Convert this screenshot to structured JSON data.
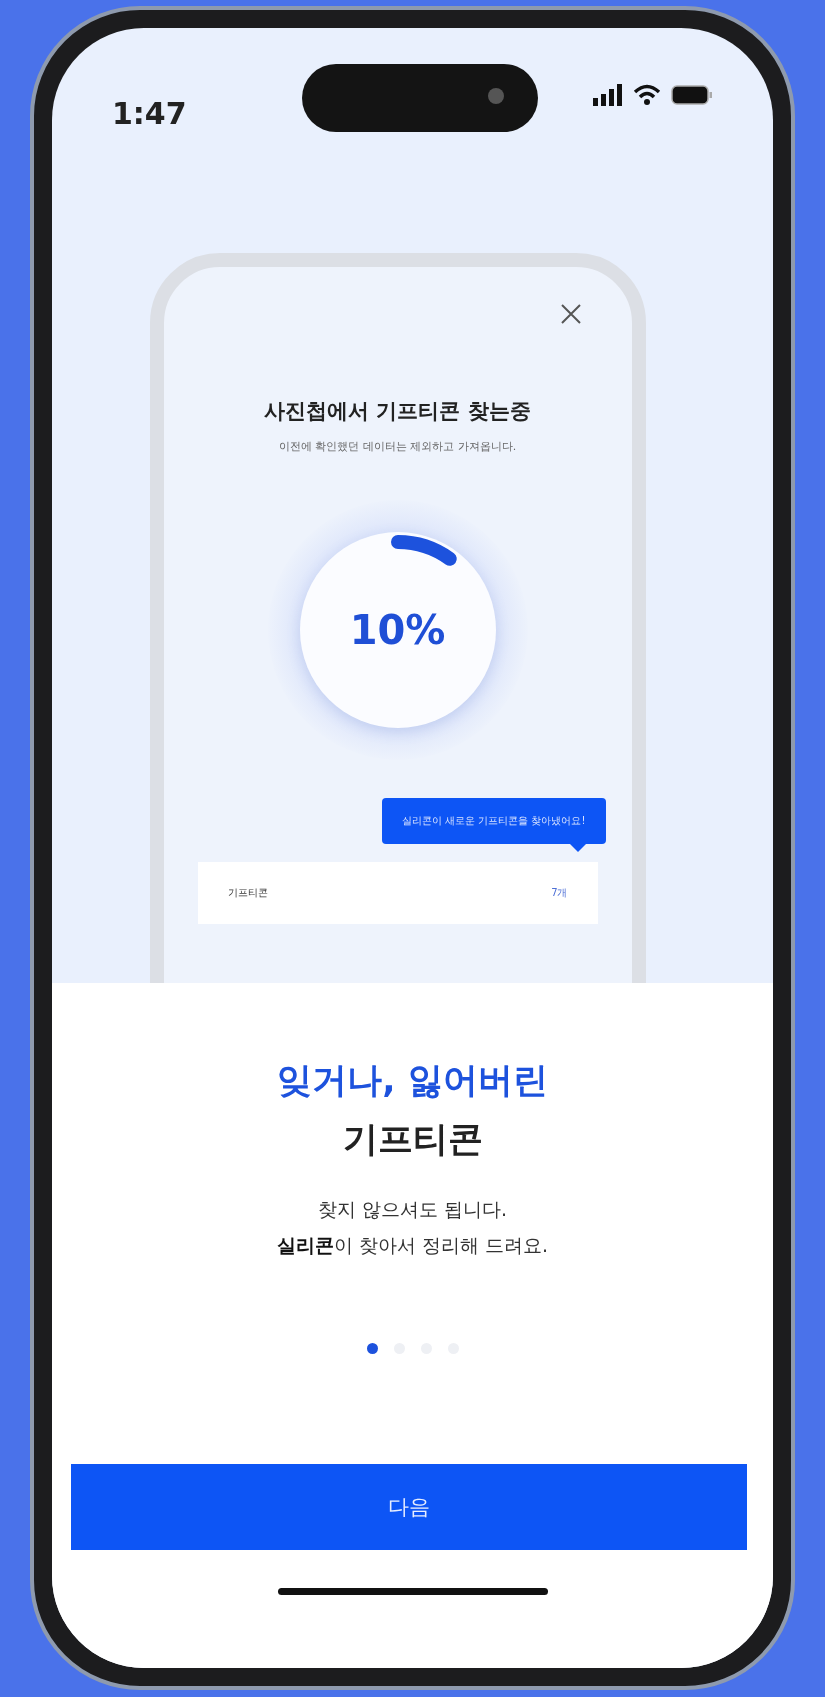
{
  "status_bar": {
    "time": "1:47"
  },
  "preview": {
    "title": "사진첩에서 기프티콘 찾는중",
    "subtitle": "이전에 확인했던 데이터는 제외하고 가져옵니다.",
    "progress": {
      "level": 0.1,
      "reading": "10%"
    },
    "tooltip": "실리콘이 새로운 기프티콘을 찾아냈어요!",
    "row": {
      "label": "기프티콘",
      "count": "7개"
    }
  },
  "headline": {
    "accent": "잊거나, 잃어버린",
    "main": "기프티콘"
  },
  "body": [
    "찾지 않으셔도 됩니다.",
    "**실리콘**이 찾아서 정리해 드려요."
  ],
  "pager": [
    {
      "selected": true
    },
    {
      "selected": false
    },
    {
      "selected": false
    },
    {
      "selected": false
    }
  ],
  "button": "다음"
}
